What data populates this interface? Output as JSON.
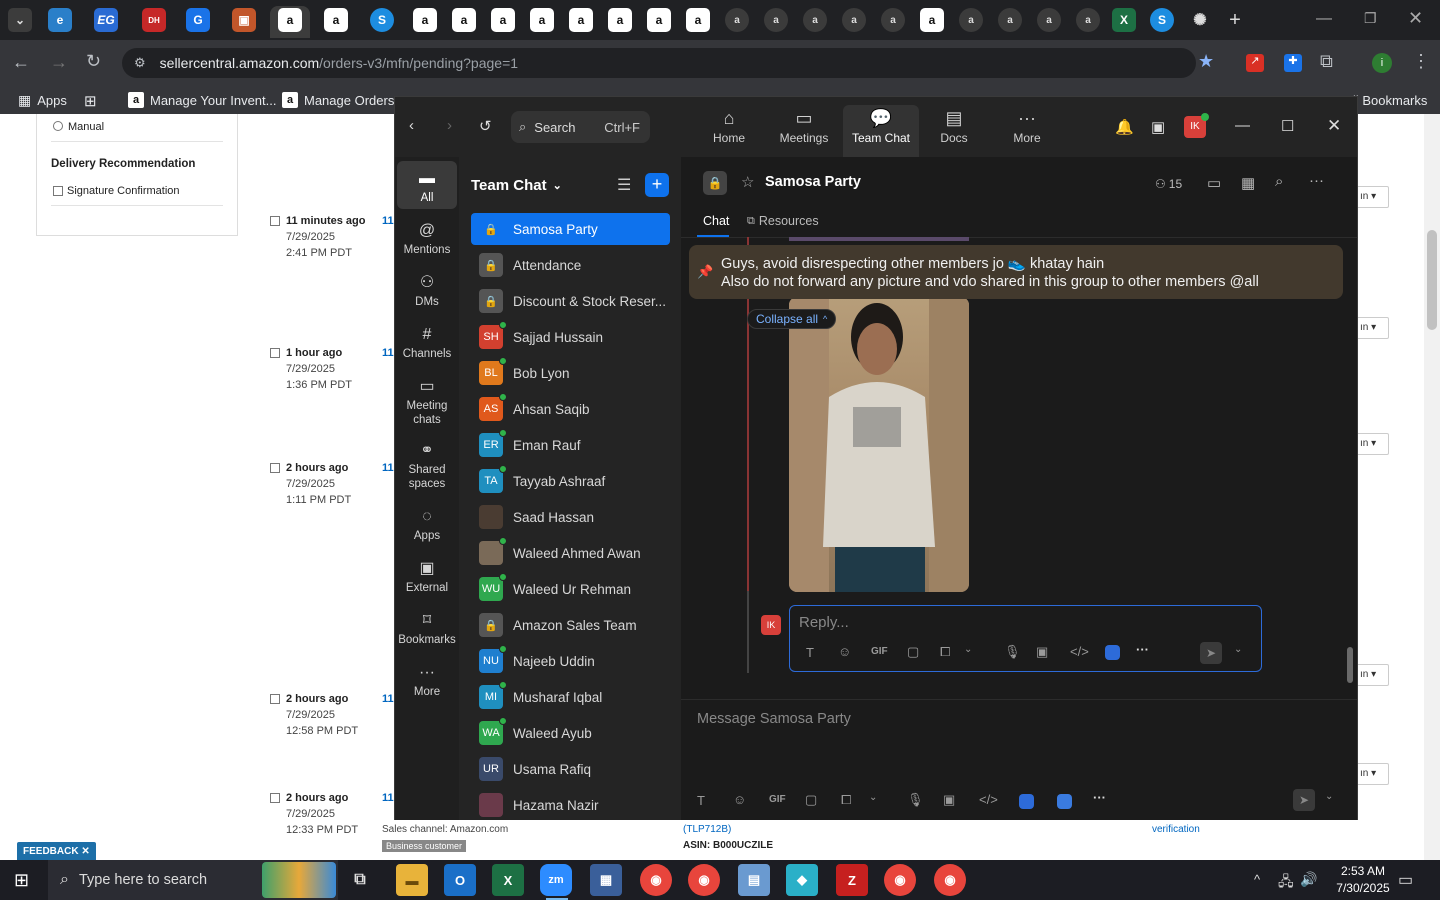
{
  "browser": {
    "url_host": "sellercentral.amazon.com",
    "url_path": "/orders-v3/mfn/pending?page=1",
    "bookmarks": [
      {
        "label": "Apps"
      },
      {
        "label": "Manage Your Invent..."
      },
      {
        "label": "Manage Orders"
      },
      {
        "label": "All Bookmarks"
      }
    ],
    "tab_icons": [
      "chevron-down",
      "ei-tab",
      "eg-tab",
      "dh-tab",
      "google-tab",
      "box-tab",
      "amazon-tab-active",
      "amazon-tab",
      "s-tab",
      "amazon-tab",
      "amazon-tab",
      "amazon-tab",
      "amazon-tab",
      "amazon-tab",
      "amazon-tab",
      "amazon-tab",
      "amazon-tab",
      "zoom-tab",
      "zoom-tab",
      "zoom-tab",
      "zoom-tab",
      "zoom-tab",
      "amazon-tab",
      "zoom-tab",
      "zoom-tab",
      "zoom-tab",
      "excel-tab",
      "s-tab",
      "chatgpt-tab"
    ]
  },
  "seller": {
    "filter_manual": "Manual",
    "delivery_heading": "Delivery Recommendation",
    "signature": "Signature Confirmation",
    "orders": [
      {
        "age": "11 minutes ago",
        "date": "7/29/2025",
        "time": "2:41 PM PDT",
        "id": "11"
      },
      {
        "age": "1 hour ago",
        "date": "7/29/2025",
        "time": "1:36 PM PDT",
        "id": "11"
      },
      {
        "age": "2 hours ago",
        "date": "7/29/2025",
        "time": "1:11 PM PDT",
        "id": "11"
      },
      {
        "age": "2 hours ago",
        "date": "7/29/2025",
        "time": "12:58 PM PDT",
        "id": "11"
      },
      {
        "age": "2 hours ago",
        "date": "7/29/2025",
        "time": "12:33 PM PDT",
        "id": "11"
      }
    ],
    "sales_channel": "Sales channel: Amazon.com",
    "business_badge": "Business customer",
    "sku": "(TLP712B)",
    "asin": "ASIN: B000UCZILE",
    "verification": "verification",
    "feedback": "FEEDBACK"
  },
  "zoom": {
    "search_label": "Search",
    "search_shortcut": "Ctrl+F",
    "nav": [
      {
        "label": "Home",
        "icon": "home-icon"
      },
      {
        "label": "Meetings",
        "icon": "video-icon"
      },
      {
        "label": "Team Chat",
        "icon": "chat-icon"
      },
      {
        "label": "Docs",
        "icon": "doc-icon"
      },
      {
        "label": "More",
        "icon": "more-icon"
      }
    ],
    "profile_initials": "IK",
    "rail": [
      {
        "label": "All"
      },
      {
        "label": "Mentions"
      },
      {
        "label": "DMs"
      },
      {
        "label": "Channels"
      },
      {
        "label": "Meeting chats"
      },
      {
        "label": "Shared spaces"
      },
      {
        "label": "Apps"
      },
      {
        "label": "External"
      },
      {
        "label": "Bookmarks"
      },
      {
        "label": "More"
      }
    ],
    "list_title": "Team Chat",
    "chats": [
      {
        "name": "Samosa Party",
        "initials": "",
        "color": "#0e72ed"
      },
      {
        "name": "Attendance",
        "initials": "",
        "color": "#555555"
      },
      {
        "name": "Discount & Stock Reser...",
        "initials": "",
        "color": "#555555"
      },
      {
        "name": "Sajjad Hussain",
        "initials": "SH",
        "color": "#d2402f"
      },
      {
        "name": "Bob Lyon",
        "initials": "BL",
        "color": "#e0791c"
      },
      {
        "name": "Ahsan Saqib",
        "initials": "AS",
        "color": "#e0591c"
      },
      {
        "name": "Eman Rauf",
        "initials": "ER",
        "color": "#1f8fbf"
      },
      {
        "name": "Tayyab Ashraaf",
        "initials": "TA",
        "color": "#1f8fbf"
      },
      {
        "name": "Saad Hassan",
        "initials": "",
        "color": "#4a3c32"
      },
      {
        "name": "Waleed Ahmed Awan",
        "initials": "",
        "color": "#7a6a58"
      },
      {
        "name": "Waleed Ur Rehman",
        "initials": "WU",
        "color": "#2fa84f"
      },
      {
        "name": "Amazon Sales Team",
        "initials": "",
        "color": "#555555"
      },
      {
        "name": "Najeeb Uddin",
        "initials": "NU",
        "color": "#1f7fcf"
      },
      {
        "name": "Musharaf Iqbal",
        "initials": "MI",
        "color": "#1f8fbf"
      },
      {
        "name": "Waleed Ayub",
        "initials": "WA",
        "color": "#2fa84f"
      },
      {
        "name": "Usama Rafiq",
        "initials": "UR",
        "color": "#3a4a6a"
      },
      {
        "name": "Hazama Nazir",
        "initials": "",
        "color": "#6a3a4a"
      }
    ],
    "channel_name": "Samosa Party",
    "member_count": "15",
    "tabs": [
      {
        "label": "Chat"
      },
      {
        "label": "Resources"
      }
    ],
    "pinned_line1": "Guys, avoid disrespecting other members jo 👟 khatay hain",
    "pinned_line2": "Also do not forward any picture and vdo shared in this group to other members @all",
    "collapse_all": "Collapse all",
    "reply_placeholder": "Reply...",
    "composer_placeholder": "Message Samosa Party",
    "gif": "GIF"
  },
  "taskbar": {
    "search_placeholder": "Type here to search",
    "time": "2:53 AM",
    "date": "7/30/2025"
  }
}
